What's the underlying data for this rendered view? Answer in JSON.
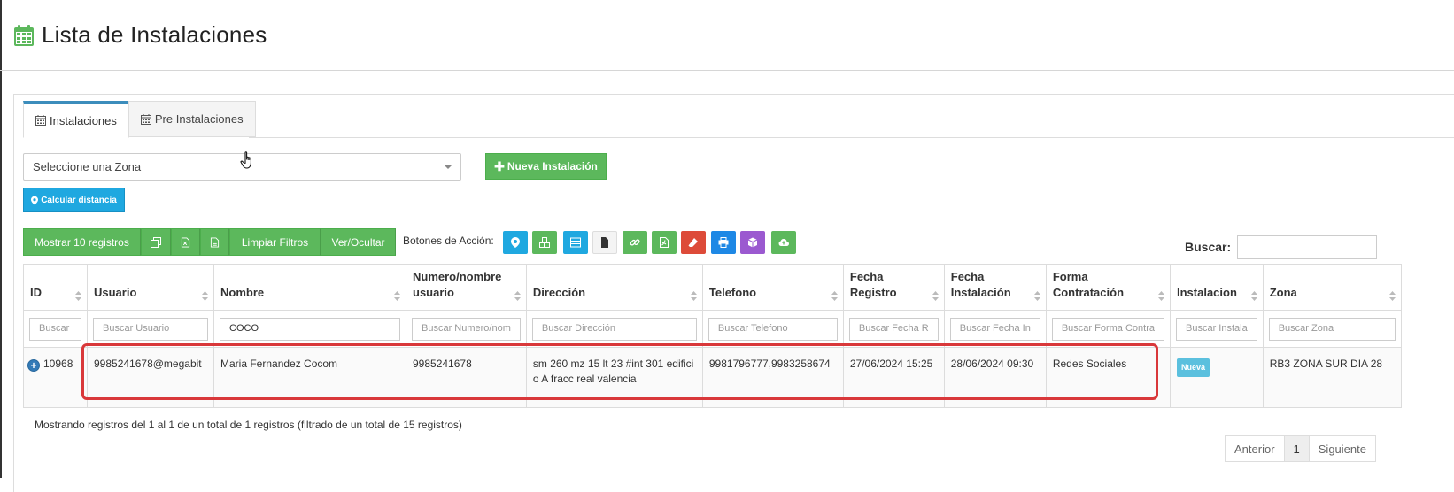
{
  "page": {
    "title": "Lista de Instalaciones"
  },
  "tabs": [
    {
      "label": "Instalaciones",
      "active": true
    },
    {
      "label": "Pre Instalaciones",
      "active": false
    }
  ],
  "zone_select": {
    "value": "Seleccione una Zona"
  },
  "buttons": {
    "new_installation": "Nueva Instalación",
    "calc_distance": "Calcular distancia"
  },
  "toolbar": {
    "show_records": "Mostrar 10 registros",
    "clear_filters": "Limpiar Filtros",
    "toggle_columns": "Ver/Ocultar",
    "action_label": "Botones de Acción:"
  },
  "action_buttons": [
    {
      "icon": "map-marker-icon",
      "color": "#1fa8e0"
    },
    {
      "icon": "cubes-icon",
      "color": "#5cb85c"
    },
    {
      "icon": "list-icon",
      "color": "#1fa8e0"
    },
    {
      "icon": "file-icon",
      "color": "#f4f4f4"
    },
    {
      "icon": "link-icon",
      "color": "#5cb85c"
    },
    {
      "icon": "pdf-icon",
      "color": "#5cb85c"
    },
    {
      "icon": "eraser-icon",
      "color": "#dd4b39"
    },
    {
      "icon": "print-icon",
      "color": "#1e88e5"
    },
    {
      "icon": "cube-icon",
      "color": "#9b59d0"
    },
    {
      "icon": "cloud-upload-icon",
      "color": "#5cb85c"
    }
  ],
  "search": {
    "label": "Buscar:",
    "value": ""
  },
  "table": {
    "columns": [
      {
        "line1": "",
        "line2": "ID",
        "filter": "Buscar"
      },
      {
        "line1": "",
        "line2": "Usuario",
        "filter": "Buscar Usuario"
      },
      {
        "line1": "",
        "line2": "Nombre",
        "filter": "COCO"
      },
      {
        "line1": "Numero/nombre",
        "line2": "usuario",
        "filter": "Buscar Numero/nom"
      },
      {
        "line1": "",
        "line2": "Dirección",
        "filter": "Buscar Dirección"
      },
      {
        "line1": "",
        "line2": "Telefono",
        "filter": "Buscar Telefono"
      },
      {
        "line1": "Fecha",
        "line2": "Registro",
        "filter": "Buscar Fecha R"
      },
      {
        "line1": "Fecha",
        "line2": "Instalación",
        "filter": "Buscar Fecha In"
      },
      {
        "line1": "Forma",
        "line2": "Contratación",
        "filter": "Buscar Forma Contra"
      },
      {
        "line1": "",
        "line2": "Instalacion",
        "filter": "Buscar Instala"
      },
      {
        "line1": "",
        "line2": "Zona",
        "filter": "Buscar Zona"
      }
    ],
    "rows": [
      {
        "id": "10968",
        "usuario": "9985241678@megabit",
        "nombre": "Maria Fernandez Cocom",
        "numero": "9985241678",
        "direccion": "sm 260 mz 15 lt 23 #int 301 edificio A fracc real valencia",
        "telefono": "9981796777,9983258674",
        "fecha_registro": "27/06/2024 15:25",
        "fecha_instalacion": "28/06/2024 09:30",
        "forma": "Redes Sociales",
        "instalacion": "Nueva",
        "zona": "RB3 ZONA SUR DIA 28"
      }
    ]
  },
  "footer": {
    "info": "Mostrando registros del 1 al 1 de un total de 1 registros (filtrado de un total de 15 registros)",
    "prev": "Anterior",
    "page": "1",
    "next": "Siguiente"
  }
}
